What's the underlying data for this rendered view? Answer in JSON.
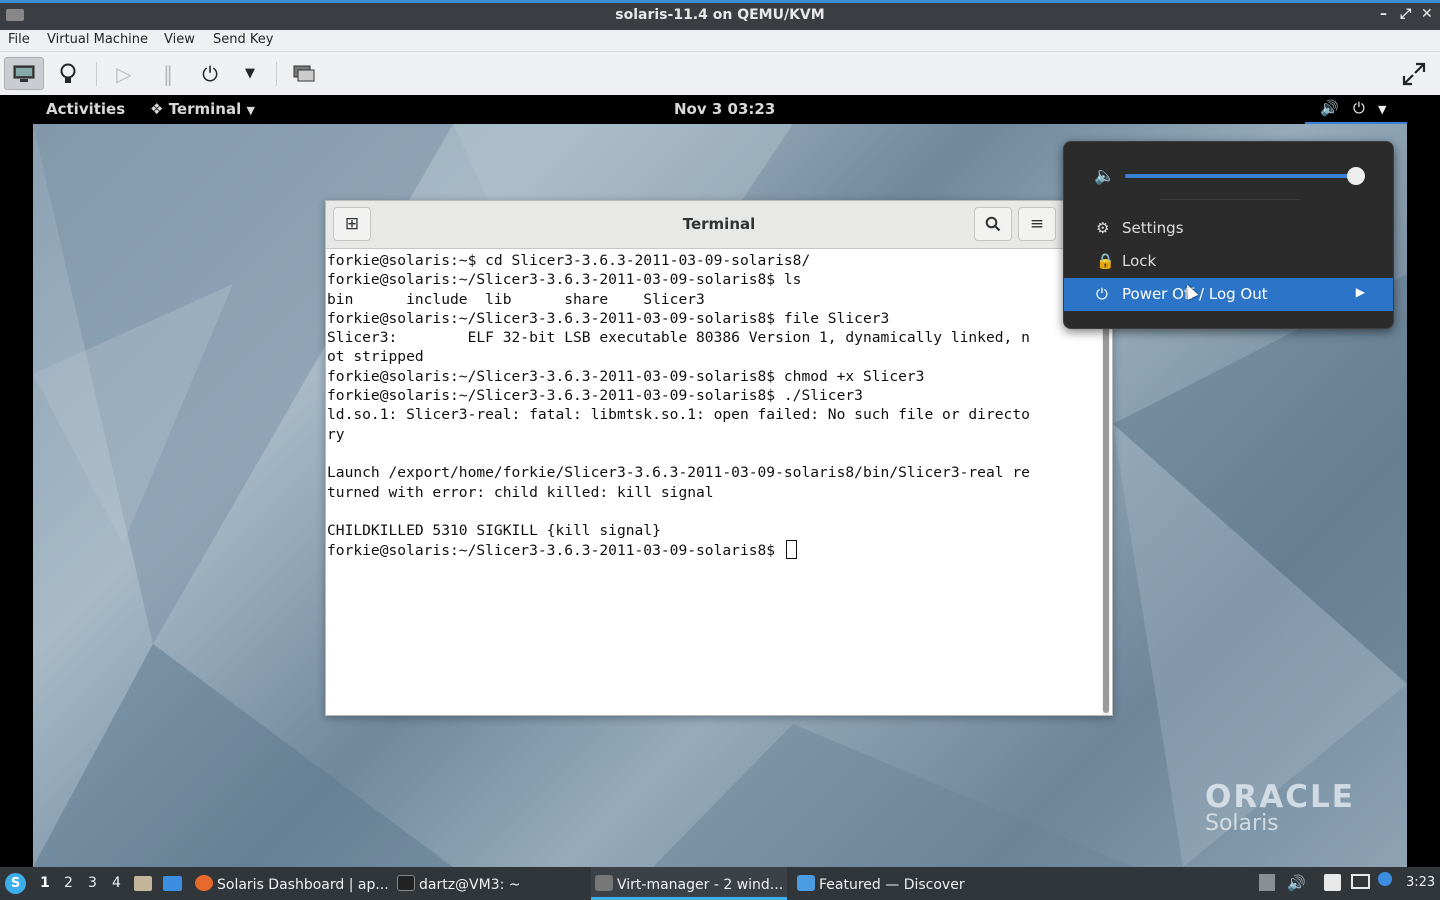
{
  "host_window": {
    "title": "solaris-11.4 on QEMU/KVM",
    "controls": [
      "–",
      "⤢",
      "✕"
    ]
  },
  "menubar": {
    "items": [
      "File",
      "Virtual Machine",
      "View",
      "Send Key"
    ]
  },
  "toolbar": {
    "icons": [
      "monitor-icon",
      "lightbulb-icon",
      "play-icon",
      "pause-icon",
      "power-icon",
      "dropdown-arrow-icon",
      "screenshot-icon",
      "fullscreen-icon"
    ]
  },
  "gnome_bar": {
    "activities": "Activities",
    "app_menu": "Terminal",
    "clock": "Nov 3  03:23"
  },
  "terminal": {
    "title": "Terminal",
    "lines": [
      "forkie@solaris:~$ cd Slicer3-3.6.3-2011-03-09-solaris8/",
      "forkie@solaris:~/Slicer3-3.6.3-2011-03-09-solaris8$ ls",
      "bin      include  lib      share    Slicer3",
      "forkie@solaris:~/Slicer3-3.6.3-2011-03-09-solaris8$ file Slicer3",
      "Slicer3:        ELF 32-bit LSB executable 80386 Version 1, dynamically linked, n",
      "ot stripped",
      "forkie@solaris:~/Slicer3-3.6.3-2011-03-09-solaris8$ chmod +x Slicer3",
      "forkie@solaris:~/Slicer3-3.6.3-2011-03-09-solaris8$ ./Slicer3",
      "ld.so.1: Slicer3-real: fatal: libmtsk.so.1: open failed: No such file or directo",
      "ry",
      "",
      "Launch /export/home/forkie/Slicer3-3.6.3-2011-03-09-solaris8/bin/Slicer3-real re",
      "turned with error: child killed: kill signal",
      "",
      "CHILDKILLED 5310 SIGKILL {kill signal}"
    ],
    "prompt": "forkie@solaris:~/Slicer3-3.6.3-2011-03-09-solaris8$ "
  },
  "system_menu": {
    "volume_level": 1.0,
    "settings": "Settings",
    "lock": "Lock",
    "power_off": "Power Off / Log Out"
  },
  "logo": {
    "line1": "ORACLE",
    "line2": "Solaris"
  },
  "taskbar": {
    "workspaces": [
      "1",
      "2",
      "3",
      "4"
    ],
    "tasks": [
      {
        "label": "Solaris Dashboard | ap...",
        "icon": "firefox-icon"
      },
      {
        "label": "dartz@VM3: ~",
        "icon": "terminal-icon"
      },
      {
        "label": "Virt-manager - 2 wind...",
        "icon": "virt-manager-icon"
      },
      {
        "label": "Featured — Discover",
        "icon": "discover-icon"
      }
    ],
    "time": "3:23"
  },
  "colors": {
    "accent": "#3b82d4",
    "taskbar": "#31363b",
    "menu_bg": "#2b2b2b"
  }
}
